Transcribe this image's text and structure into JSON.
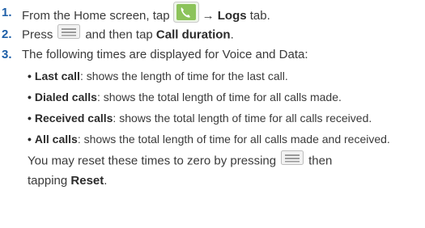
{
  "steps": [
    {
      "number": "1.",
      "before": "From the Home screen, tap",
      "icon": "phone-icon",
      "arrow": "→",
      "bold": "Logs",
      "after": " tab."
    },
    {
      "number": "2.",
      "before": "Press",
      "icon": "menu-key-icon",
      "middle": "and then tap ",
      "bold": "Call duration",
      "after": "."
    },
    {
      "number": "3.",
      "text": "The following times are displayed for Voice and Data:",
      "bullets": [
        {
          "label": "Last call",
          "desc": ": shows the length of time for the last call."
        },
        {
          "label": "Dialed calls",
          "desc": ": shows the total length of time for all calls made."
        },
        {
          "label": "Received calls",
          "desc": ": shows the total length of time for all calls received."
        },
        {
          "label": "All calls",
          "desc": ": shows the total length of time for all calls made and received."
        }
      ],
      "reset_before": "You may reset these times to zero by pressing",
      "reset_icon": "menu-key-icon",
      "reset_middle": "then",
      "reset_line2_before": "tapping ",
      "reset_bold": "Reset",
      "reset_after": "."
    }
  ],
  "colors": {
    "number": "#1d5fa8",
    "text": "#3a3a3a",
    "icon_green": "#7ab547",
    "icon_gray": "#b5b5b5"
  }
}
